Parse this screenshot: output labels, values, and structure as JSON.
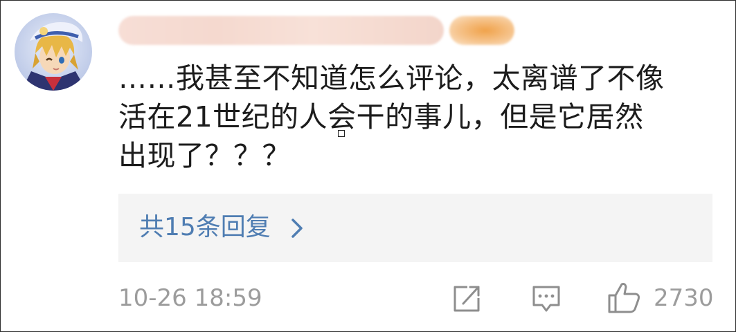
{
  "comment": {
    "author_redacted": true,
    "text": "……我甚至不知道怎么评论，太离谱了不像\n活在21世纪的人会干的事儿，但是它居然\n出现了？？？",
    "replies_label": "共15条回复",
    "timestamp": "10-26 18:59",
    "like_count": "2730"
  },
  "icons": {
    "share": "share-icon",
    "reply": "comment-icon",
    "like": "thumbs-up-icon",
    "chevron": "chevron-right-icon"
  },
  "colors": {
    "link_blue": "#4f7db2",
    "meta_gray": "#9c9c9c",
    "reply_bg": "#f4f4f4",
    "text": "#1c1c1c"
  }
}
